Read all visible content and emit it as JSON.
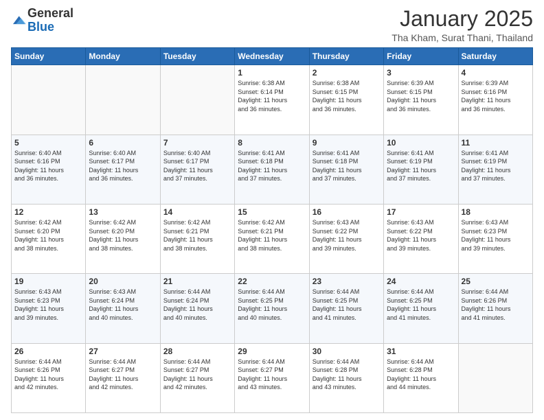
{
  "header": {
    "logo_line1": "General",
    "logo_line2": "Blue",
    "month": "January 2025",
    "location": "Tha Kham, Surat Thani, Thailand"
  },
  "days_of_week": [
    "Sunday",
    "Monday",
    "Tuesday",
    "Wednesday",
    "Thursday",
    "Friday",
    "Saturday"
  ],
  "weeks": [
    [
      {
        "day": "",
        "info": ""
      },
      {
        "day": "",
        "info": ""
      },
      {
        "day": "",
        "info": ""
      },
      {
        "day": "1",
        "info": "Sunrise: 6:38 AM\nSunset: 6:14 PM\nDaylight: 11 hours\nand 36 minutes."
      },
      {
        "day": "2",
        "info": "Sunrise: 6:38 AM\nSunset: 6:15 PM\nDaylight: 11 hours\nand 36 minutes."
      },
      {
        "day": "3",
        "info": "Sunrise: 6:39 AM\nSunset: 6:15 PM\nDaylight: 11 hours\nand 36 minutes."
      },
      {
        "day": "4",
        "info": "Sunrise: 6:39 AM\nSunset: 6:16 PM\nDaylight: 11 hours\nand 36 minutes."
      }
    ],
    [
      {
        "day": "5",
        "info": "Sunrise: 6:40 AM\nSunset: 6:16 PM\nDaylight: 11 hours\nand 36 minutes."
      },
      {
        "day": "6",
        "info": "Sunrise: 6:40 AM\nSunset: 6:17 PM\nDaylight: 11 hours\nand 36 minutes."
      },
      {
        "day": "7",
        "info": "Sunrise: 6:40 AM\nSunset: 6:17 PM\nDaylight: 11 hours\nand 37 minutes."
      },
      {
        "day": "8",
        "info": "Sunrise: 6:41 AM\nSunset: 6:18 PM\nDaylight: 11 hours\nand 37 minutes."
      },
      {
        "day": "9",
        "info": "Sunrise: 6:41 AM\nSunset: 6:18 PM\nDaylight: 11 hours\nand 37 minutes."
      },
      {
        "day": "10",
        "info": "Sunrise: 6:41 AM\nSunset: 6:19 PM\nDaylight: 11 hours\nand 37 minutes."
      },
      {
        "day": "11",
        "info": "Sunrise: 6:41 AM\nSunset: 6:19 PM\nDaylight: 11 hours\nand 37 minutes."
      }
    ],
    [
      {
        "day": "12",
        "info": "Sunrise: 6:42 AM\nSunset: 6:20 PM\nDaylight: 11 hours\nand 38 minutes."
      },
      {
        "day": "13",
        "info": "Sunrise: 6:42 AM\nSunset: 6:20 PM\nDaylight: 11 hours\nand 38 minutes."
      },
      {
        "day": "14",
        "info": "Sunrise: 6:42 AM\nSunset: 6:21 PM\nDaylight: 11 hours\nand 38 minutes."
      },
      {
        "day": "15",
        "info": "Sunrise: 6:42 AM\nSunset: 6:21 PM\nDaylight: 11 hours\nand 38 minutes."
      },
      {
        "day": "16",
        "info": "Sunrise: 6:43 AM\nSunset: 6:22 PM\nDaylight: 11 hours\nand 39 minutes."
      },
      {
        "day": "17",
        "info": "Sunrise: 6:43 AM\nSunset: 6:22 PM\nDaylight: 11 hours\nand 39 minutes."
      },
      {
        "day": "18",
        "info": "Sunrise: 6:43 AM\nSunset: 6:23 PM\nDaylight: 11 hours\nand 39 minutes."
      }
    ],
    [
      {
        "day": "19",
        "info": "Sunrise: 6:43 AM\nSunset: 6:23 PM\nDaylight: 11 hours\nand 39 minutes."
      },
      {
        "day": "20",
        "info": "Sunrise: 6:43 AM\nSunset: 6:24 PM\nDaylight: 11 hours\nand 40 minutes."
      },
      {
        "day": "21",
        "info": "Sunrise: 6:44 AM\nSunset: 6:24 PM\nDaylight: 11 hours\nand 40 minutes."
      },
      {
        "day": "22",
        "info": "Sunrise: 6:44 AM\nSunset: 6:25 PM\nDaylight: 11 hours\nand 40 minutes."
      },
      {
        "day": "23",
        "info": "Sunrise: 6:44 AM\nSunset: 6:25 PM\nDaylight: 11 hours\nand 41 minutes."
      },
      {
        "day": "24",
        "info": "Sunrise: 6:44 AM\nSunset: 6:25 PM\nDaylight: 11 hours\nand 41 minutes."
      },
      {
        "day": "25",
        "info": "Sunrise: 6:44 AM\nSunset: 6:26 PM\nDaylight: 11 hours\nand 41 minutes."
      }
    ],
    [
      {
        "day": "26",
        "info": "Sunrise: 6:44 AM\nSunset: 6:26 PM\nDaylight: 11 hours\nand 42 minutes."
      },
      {
        "day": "27",
        "info": "Sunrise: 6:44 AM\nSunset: 6:27 PM\nDaylight: 11 hours\nand 42 minutes."
      },
      {
        "day": "28",
        "info": "Sunrise: 6:44 AM\nSunset: 6:27 PM\nDaylight: 11 hours\nand 42 minutes."
      },
      {
        "day": "29",
        "info": "Sunrise: 6:44 AM\nSunset: 6:27 PM\nDaylight: 11 hours\nand 43 minutes."
      },
      {
        "day": "30",
        "info": "Sunrise: 6:44 AM\nSunset: 6:28 PM\nDaylight: 11 hours\nand 43 minutes."
      },
      {
        "day": "31",
        "info": "Sunrise: 6:44 AM\nSunset: 6:28 PM\nDaylight: 11 hours\nand 44 minutes."
      },
      {
        "day": "",
        "info": ""
      }
    ]
  ]
}
